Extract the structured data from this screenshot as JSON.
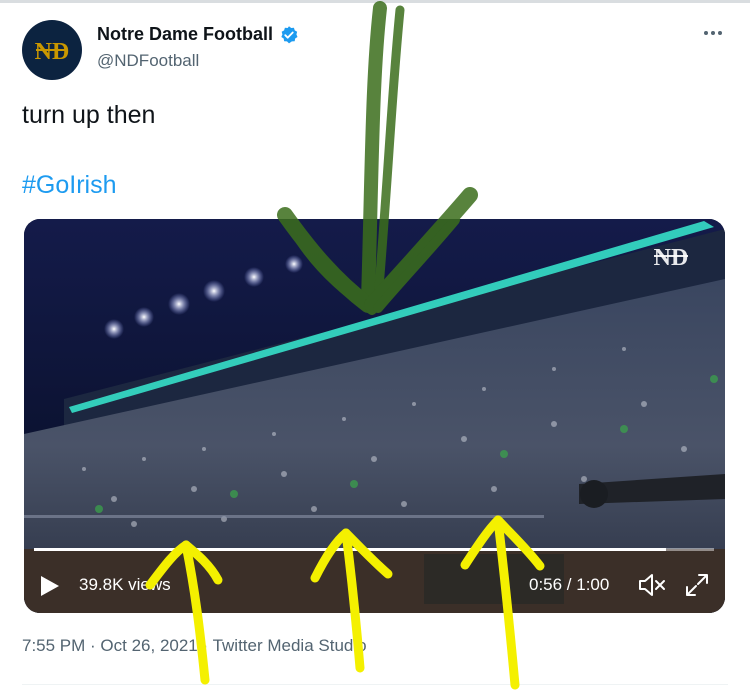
{
  "author": {
    "display_name": "Notre Dame Football",
    "handle": "@NDFootball",
    "verified": true,
    "avatar_icon": "nd-monogram-icon"
  },
  "tweet": {
    "text": "turn up then",
    "hashtag": "#GoIrish"
  },
  "video": {
    "views": "39.8K views",
    "time": "0:56 / 1:00",
    "progress": 0.93,
    "watermark_icon": "nd-monogram-icon"
  },
  "meta": {
    "time": "7:55 PM",
    "separator": " · ",
    "date": "Oct 26, 2021",
    "source": "Twitter Media Studio"
  },
  "colors": {
    "link_blue": "#1d9bf0",
    "verified_blue": "#1d9bf0",
    "navy": "#0c2340",
    "gold": "#c99700",
    "annotation_green": "#3b6e1c",
    "annotation_yellow": "#f4f000",
    "ribbon_cyan": "#36e0c9"
  }
}
